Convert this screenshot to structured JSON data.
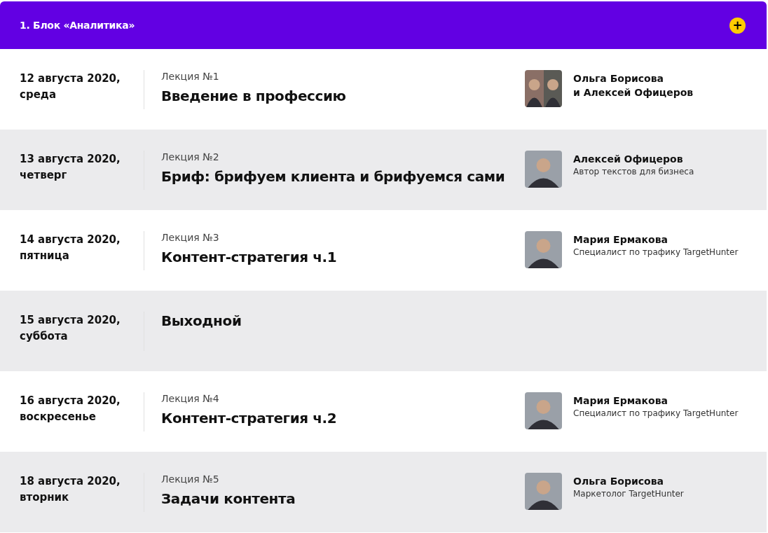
{
  "block": {
    "title": "1. Блок «Аналитика»",
    "expand_button": "+"
  },
  "rows": [
    {
      "date": "12 августа 2020,",
      "weekday": "среда",
      "lecture": "Лекция №1",
      "title": "Введение в профессию",
      "speaker": {
        "kind": "pair",
        "name_lines": [
          "Ольга Борисова",
          "и Алексей Офицеров"
        ]
      }
    },
    {
      "date": "13 августа 2020,",
      "weekday": "четверг",
      "lecture": "Лекция №2",
      "title": "Бриф: брифуем клиента и брифуемся сами",
      "speaker": {
        "kind": "single",
        "name_lines": [
          "Алексей Офицеров"
        ],
        "role": "Автор текстов для бизнеса"
      }
    },
    {
      "date": "14 августа 2020,",
      "weekday": "пятница",
      "lecture": "Лекция №3",
      "title": "Контент-стратегия ч.1",
      "speaker": {
        "kind": "single",
        "name_lines": [
          "Мария Ермакова"
        ],
        "role": "Специалист по трафику TargetHunter"
      }
    },
    {
      "date": "15 августа 2020,",
      "weekday": "суббота",
      "title": "Выходной"
    },
    {
      "date": "16 августа 2020,",
      "weekday": "воскресенье",
      "lecture": "Лекция №4",
      "title": "Контент-стратегия ч.2",
      "speaker": {
        "kind": "single",
        "name_lines": [
          "Мария Ермакова"
        ],
        "role": "Специалист по трафику TargetHunter"
      }
    },
    {
      "date": "18 августа 2020,",
      "weekday": "вторник",
      "lecture": "Лекция №5",
      "title": "Задачи контента",
      "speaker": {
        "kind": "single",
        "name_lines": [
          "Ольга Борисова"
        ],
        "role": "Маркетолог TargetHunter"
      }
    }
  ]
}
